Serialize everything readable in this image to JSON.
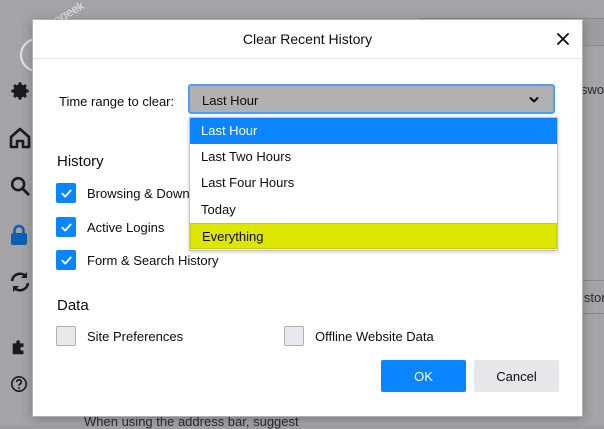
{
  "background": {
    "logo_text": "orogeek",
    "right_text_1": "swo",
    "right_text_2": "istory",
    "bottom_text": "When using the address bar, suggest"
  },
  "sidebar_icons": [
    "gear-icon",
    "home-icon",
    "search-icon",
    "lock-icon",
    "sync-icon",
    "puzzle-icon",
    "help-icon"
  ],
  "dialog": {
    "title": "Clear Recent History",
    "range_label": "Time range to clear:",
    "range_selected": "Last Hour",
    "range_options": [
      "Last Hour",
      "Last Two Hours",
      "Last Four Hours",
      "Today",
      "Everything"
    ],
    "history": {
      "title": "History",
      "items": [
        {
          "label": "Browsing & Download History",
          "checked": true
        },
        {
          "label": "Active Logins",
          "checked": true
        },
        {
          "label": "Form & Search History",
          "checked": true
        }
      ]
    },
    "data": {
      "title": "Data",
      "items": [
        {
          "label": "Site Preferences",
          "checked": false
        },
        {
          "label": "Offline Website Data",
          "checked": false
        }
      ]
    },
    "ok_label": "OK",
    "cancel_label": "Cancel"
  },
  "colors": {
    "accent": "#0a84ff",
    "highlight": "#dde600",
    "focus_ring": "#45a1ff"
  }
}
